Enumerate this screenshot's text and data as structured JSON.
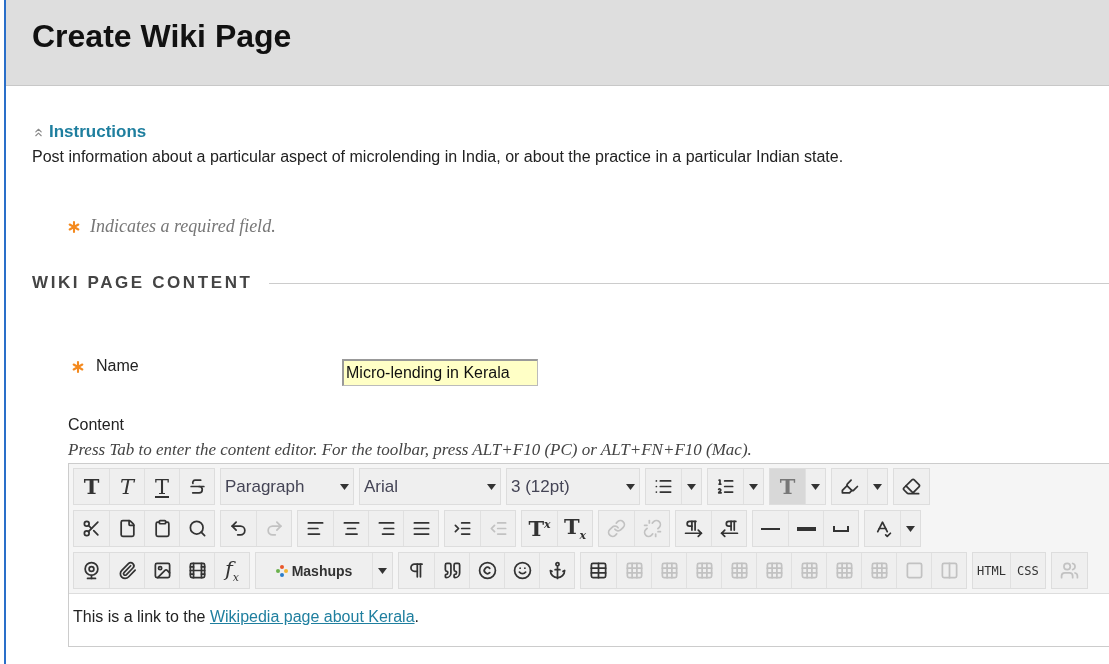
{
  "header": {
    "title": "Create Wiki Page"
  },
  "instructions": {
    "toggle": "Instructions",
    "expanded": true,
    "text": "Post information about a particular aspect of microlending in India, or about the practice in a particular Indian state."
  },
  "required_note": {
    "text": "Indicates a required field."
  },
  "section": {
    "title": "WIKI PAGE CONTENT"
  },
  "fields": [
    {
      "label": "Name",
      "required": true,
      "value": "Micro-lending in Kerala"
    }
  ],
  "content": {
    "label": "Content",
    "hint": "Press Tab to enter the content editor. For the toolbar, press ALT+F10 (PC) or ALT+FN+F10 (Mac).",
    "toolbar": [
      {
        "groups": [
          {
            "items": [
              {
                "kind": "bold",
                "label": "T",
                "disabled": false,
                "pressed": false
              },
              {
                "kind": "italic",
                "label": "T",
                "disabled": false,
                "pressed": false
              },
              {
                "kind": "underline",
                "label": "T",
                "disabled": false,
                "pressed": false
              },
              {
                "kind": "icon",
                "disabled": false,
                "pressed": false
              }
            ]
          },
          {
            "items": [
              {
                "kind": "select",
                "label": "Paragraph",
                "disabled": false,
                "pressed": false
              }
            ]
          },
          {
            "items": [
              {
                "kind": "select",
                "label": "Arial",
                "disabled": false,
                "pressed": false
              }
            ]
          },
          {
            "items": [
              {
                "kind": "select",
                "label": "3 (12pt)",
                "disabled": false,
                "pressed": false
              }
            ]
          },
          {
            "items": [
              {
                "kind": "icon",
                "disabled": false,
                "pressed": false
              },
              {
                "kind": "caret",
                "disabled": false,
                "pressed": false
              }
            ]
          },
          {
            "items": [
              {
                "kind": "icon",
                "disabled": false,
                "pressed": false
              },
              {
                "kind": "caret",
                "disabled": false,
                "pressed": false
              }
            ]
          },
          {
            "items": [
              {
                "kind": "serif",
                "label": "T",
                "disabled": false,
                "pressed": true
              },
              {
                "kind": "caret",
                "disabled": false,
                "pressed": false
              }
            ]
          },
          {
            "items": [
              {
                "kind": "icon",
                "disabled": false,
                "pressed": false
              },
              {
                "kind": "caret",
                "disabled": false,
                "pressed": false
              }
            ]
          },
          {
            "items": [
              {
                "kind": "icon",
                "disabled": false,
                "pressed": false
              }
            ]
          }
        ]
      },
      {
        "groups": [
          {
            "items": [
              {
                "kind": "icon",
                "disabled": false,
                "pressed": false
              },
              {
                "kind": "icon",
                "disabled": false,
                "pressed": false
              },
              {
                "kind": "icon",
                "disabled": false,
                "pressed": false
              },
              {
                "kind": "icon",
                "disabled": false,
                "pressed": false
              }
            ]
          },
          {
            "items": [
              {
                "kind": "icon",
                "disabled": false,
                "pressed": false
              },
              {
                "kind": "icon",
                "disabled": true,
                "pressed": false
              }
            ]
          },
          {
            "items": [
              {
                "kind": "icon",
                "disabled": false,
                "pressed": false
              },
              {
                "kind": "icon",
                "disabled": false,
                "pressed": false
              },
              {
                "kind": "icon",
                "disabled": false,
                "pressed": false
              },
              {
                "kind": "icon",
                "disabled": false,
                "pressed": false
              }
            ]
          },
          {
            "items": [
              {
                "kind": "icon",
                "disabled": false,
                "pressed": false
              },
              {
                "kind": "icon",
                "disabled": true,
                "pressed": false
              }
            ]
          },
          {
            "items": [
              {
                "kind": "serif",
                "label": "T$^{x}$",
                "disabled": false,
                "pressed": false
              },
              {
                "kind": "serif",
                "label": "T$_{x}$",
                "disabled": false,
                "pressed": false
              }
            ]
          },
          {
            "items": [
              {
                "kind": "icon",
                "disabled": true,
                "pressed": false
              },
              {
                "kind": "icon",
                "disabled": true,
                "pressed": false
              }
            ]
          },
          {
            "items": [
              {
                "kind": "icon",
                "disabled": false,
                "pressed": false
              },
              {
                "kind": "icon",
                "disabled": false,
                "pressed": false
              }
            ]
          },
          {
            "items": [
              {
                "kind": "icon",
                "disabled": false,
                "pressed": false
              },
              {
                "kind": "icon",
                "disabled": false,
                "pressed": false
              },
              {
                "kind": "icon",
                "disabled": false,
                "pressed": false
              }
            ]
          },
          {
            "items": [
              {
                "kind": "icon",
                "disabled": false,
                "pressed": false
              },
              {
                "kind": "caret",
                "disabled": false,
                "pressed": false
              }
            ]
          }
        ]
      },
      {
        "groups": [
          {
            "items": [
              {
                "kind": "icon",
                "disabled": false,
                "pressed": false
              },
              {
                "kind": "icon",
                "disabled": false,
                "pressed": false
              },
              {
                "kind": "icon",
                "disabled": false,
                "pressed": false
              },
              {
                "kind": "icon",
                "disabled": false,
                "pressed": false
              },
              {
                "kind": "italic",
                "label": "f$_{x}$",
                "disabled": false,
                "pressed": false
              }
            ]
          },
          {
            "items": [
              {
                "kind": "mashup",
                "label": "Mashups",
                "disabled": false,
                "pressed": false
              },
              {
                "kind": "caret",
                "disabled": false,
                "pressed": false
              }
            ]
          },
          {
            "items": [
              {
                "kind": "icon",
                "disabled": false,
                "pressed": false
              },
              {
                "kind": "icon",
                "disabled": false,
                "pressed": false
              },
              {
                "kind": "icon",
                "disabled": false,
                "pressed": false
              },
              {
                "kind": "icon",
                "disabled": false,
                "pressed": false
              },
              {
                "kind": "icon",
                "disabled": false,
                "pressed": false
              }
            ]
          },
          {
            "items": [
              {
                "kind": "icon",
                "disabled": false,
                "pressed": false
              },
              {
                "kind": "icon",
                "disabled": true,
                "pressed": false
              },
              {
                "kind": "icon",
                "disabled": true,
                "pressed": false
              },
              {
                "kind": "icon",
                "disabled": true,
                "pressed": false
              },
              {
                "kind": "icon",
                "disabled": true,
                "pressed": false
              },
              {
                "kind": "icon",
                "disabled": true,
                "pressed": false
              },
              {
                "kind": "icon",
                "disabled": true,
                "pressed": false
              },
              {
                "kind": "icon",
                "disabled": true,
                "pressed": false
              },
              {
                "kind": "icon",
                "disabled": true,
                "pressed": false
              },
              {
                "kind": "icon",
                "disabled": true,
                "pressed": false
              },
              {
                "kind": "icon",
                "disabled": true,
                "pressed": false
              }
            ]
          },
          {
            "items": [
              {
                "kind": "mono",
                "label": "HTML",
                "disabled": false,
                "pressed": false
              },
              {
                "kind": "mono",
                "label": "CSS",
                "disabled": false,
                "pressed": false
              }
            ]
          },
          {
            "items": [
              {
                "kind": "icon",
                "disabled": true,
                "pressed": false
              }
            ]
          }
        ]
      }
    ],
    "body": {
      "text_before": "This is a link to the ",
      "link": "Wikipedia page about Kerala",
      "text_after": "."
    }
  }
}
